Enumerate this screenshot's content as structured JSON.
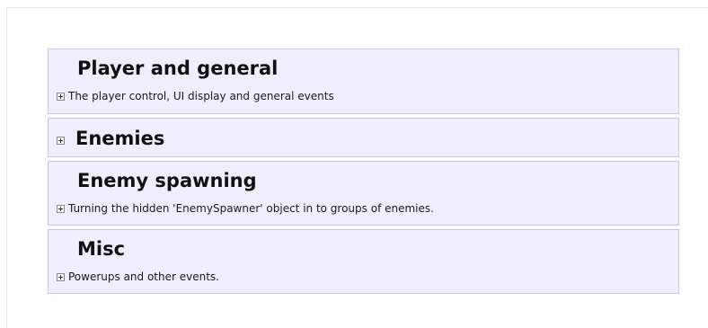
{
  "groups": [
    {
      "title": "Player and general",
      "description": "The player control, UI display and general events",
      "expander_icon": "plus-expander-icon"
    },
    {
      "title": "Enemies",
      "description": "",
      "expander_icon": "plus-expander-icon"
    },
    {
      "title": "Enemy spawning",
      "description": "Turning the hidden 'EnemySpawner' object in to groups of enemies.",
      "expander_icon": "plus-expander-icon"
    },
    {
      "title": "Misc",
      "description": "Powerups and other events.",
      "expander_icon": "plus-expander-icon"
    }
  ],
  "colors": {
    "group_background": "#f0eefd",
    "group_border": "#c9c3ef",
    "title_text": "#111111"
  }
}
